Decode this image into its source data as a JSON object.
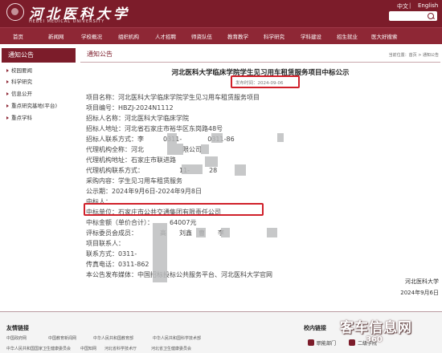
{
  "header": {
    "logo_text": "河北医科大学",
    "logo_subtitle": "HEBEI MEDICAL UNIVERSITY",
    "lang_cn": "中文",
    "lang_sep": "|",
    "lang_en": "English"
  },
  "nav": {
    "items": [
      "首页",
      "新闻网",
      "学校概况",
      "组织机构",
      "人才招聘",
      "师资队伍",
      "教育教学",
      "科学研究",
      "学科建设",
      "招生就业",
      "医大好搜索"
    ]
  },
  "sidebar": {
    "title": "通知公告",
    "items": [
      "校园要闻",
      "科学研究",
      "信息公开",
      "重点研究基地(平台)",
      "重点学科"
    ]
  },
  "content": {
    "tab_title": "通知公告",
    "breadcrumb": "当前位置：首页 > 通知公告",
    "article_title": "河北医科大学临床学院学生见习用车租赁服务项目中标公示",
    "publish_date": "发布时间：2024-09-06",
    "lines": [
      "项目名称：河北医科大学临床学院学生见习用车租赁服务项目",
      "项目编号：HBZJ-2024N1112",
      "招标人名称：河北医科大学临床学院",
      "招标人地址：河北省石家庄市裕华区东岗路48号",
      "招标人联系方式：李　　　0311-　　　　0311-86",
      "代理机构全称：河北　　　　　　限公司",
      "代理机构地址：石家庄市联进路",
      "代理机构联系方式：　　　　　　11-　　　28",
      "采购内容：学生见习用车租赁服务",
      "公示期：2024年9月6日-2024年9月8日",
      "中标人：",
      "中标单位：石家庄市公共交通集团有限责任公司",
      "中标金额（单价合计）：　　　64007元",
      "评标委员会成员：　　　　高　　刘鑫　曹　　李",
      "项目联系人：",
      "联系方式：0311-",
      "传真电话：0311-862",
      "本公告发布媒体：中国招标投标公共服务平台、河北医科大学官网"
    ],
    "signature_org": "河北医科大学",
    "signature_date": "2024年9月6日"
  },
  "footer": {
    "links_title": "友情链接",
    "links": [
      "中国政府网",
      "中国教育新闻网",
      "中华人民共和国教育部",
      "中华人民共和国科学技术部",
      "中华人民共和国国家卫生健康委员会",
      "中国知网",
      "河北省科学技术厅",
      "河北省卫生健康委员会"
    ],
    "campus_title": "校内链接",
    "campus_links": [
      "职能部门",
      "二级学院"
    ]
  },
  "watermark": {
    "text": "客车信息网",
    "sub": "360"
  },
  "colors": {
    "brand": "#7c1c2a",
    "nav": "#8e2735",
    "highlight": "#d0202a"
  }
}
